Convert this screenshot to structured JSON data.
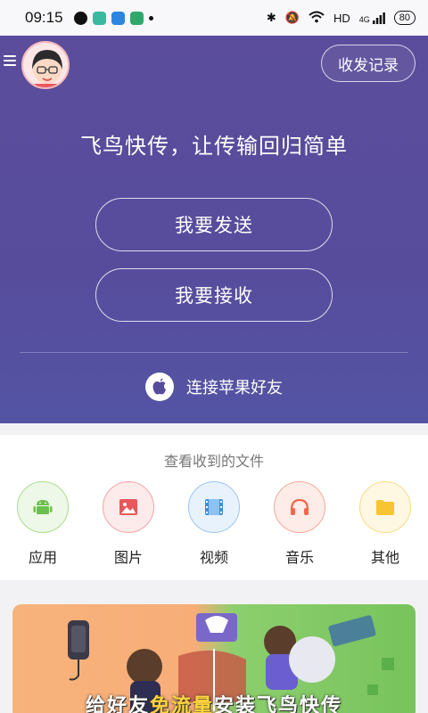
{
  "status_bar": {
    "time": "09:15",
    "network": "HD",
    "signal": "4G",
    "battery": "80"
  },
  "header": {
    "records_label": "收发记录"
  },
  "hero": {
    "slogan": "飞鸟快传，让传输回归简单",
    "send_label": "我要发送",
    "receive_label": "我要接收",
    "apple_label": "连接苹果好友"
  },
  "files": {
    "title": "查看收到的文件",
    "categories": [
      {
        "label": "应用",
        "icon": "android-icon",
        "color": "#6cbf4a"
      },
      {
        "label": "图片",
        "icon": "image-icon",
        "color": "#e8575a"
      },
      {
        "label": "视频",
        "icon": "video-icon",
        "color": "#3b8fd8"
      },
      {
        "label": "音乐",
        "icon": "headphones-icon",
        "color": "#f0674a"
      },
      {
        "label": "其他",
        "icon": "folder-icon",
        "color": "#f6c531"
      }
    ]
  },
  "banner": {
    "text_before": "给好友",
    "text_highlight": "免流量",
    "text_after": "安装飞鸟快传"
  }
}
